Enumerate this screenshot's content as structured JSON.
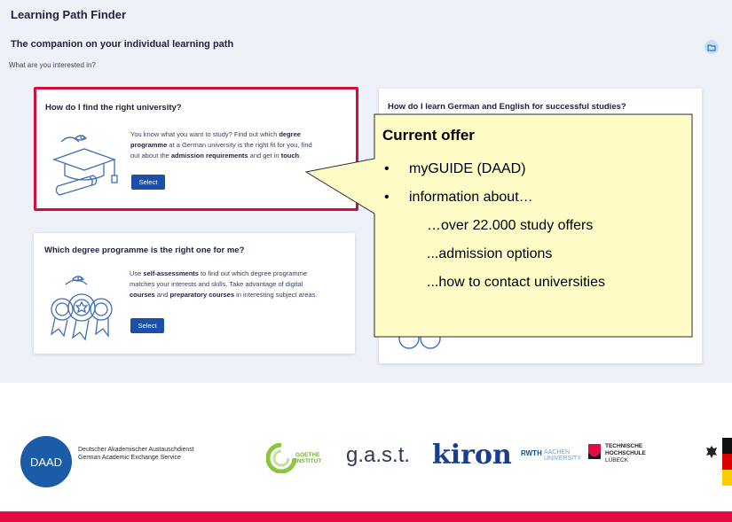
{
  "app": {
    "title": "Learning Path Finder",
    "subtitle": "The companion on your individual learning path",
    "question": "What are you interested in?"
  },
  "cards": [
    {
      "title": "How do I find the right university?",
      "text_html": "You know what you want to study? Find out which <b>degree programme</b> at a German university is the right fit for you, find out about the <b>admission requirements</b> and get in <b>touch</b>.",
      "button": "Select",
      "selected": true
    },
    {
      "title": "How do I learn German and English for successful studies?",
      "selected": false
    },
    {
      "title": "Which degree programme is the right one for me?",
      "text_html": "Use <b>self-assessments</b> to find out which degree programme matches your interests and skills. Take advantage of digital <b>courses</b> and <b>preparatory courses</b> in interesting subject areas.",
      "button": "Select",
      "selected": false
    }
  ],
  "callout": {
    "title": "Current offer",
    "items": [
      "myGUIDE (DAAD)",
      "information about…",
      "…over 22.000 study offers",
      "...admission options",
      "...how to contact universities"
    ]
  },
  "partners": {
    "daad_badge": "DAAD",
    "daad_line1": "Deutscher Akademischer Austauschdienst",
    "daad_line2": "German Academic Exchange Service",
    "goethe_line1": "GOETHE",
    "goethe_line2": "INSTITUT",
    "gast": "g.a.s.t.",
    "kiron": "kiron",
    "rwth": "RWTH",
    "rwth_line1": "AACHEN",
    "rwth_line2": "UNIVERSITY",
    "th_line1": "TECHNISCHE",
    "th_line2": "HOCHSCHULE",
    "th_line3": "LÜBECK"
  },
  "colors": {
    "accent_red": "#d0103a",
    "button_blue": "#1b4fa8",
    "panel_bg": "#eef1f8",
    "callout_bg": "#fffbc6",
    "bottom_bar": "#e30a45"
  }
}
